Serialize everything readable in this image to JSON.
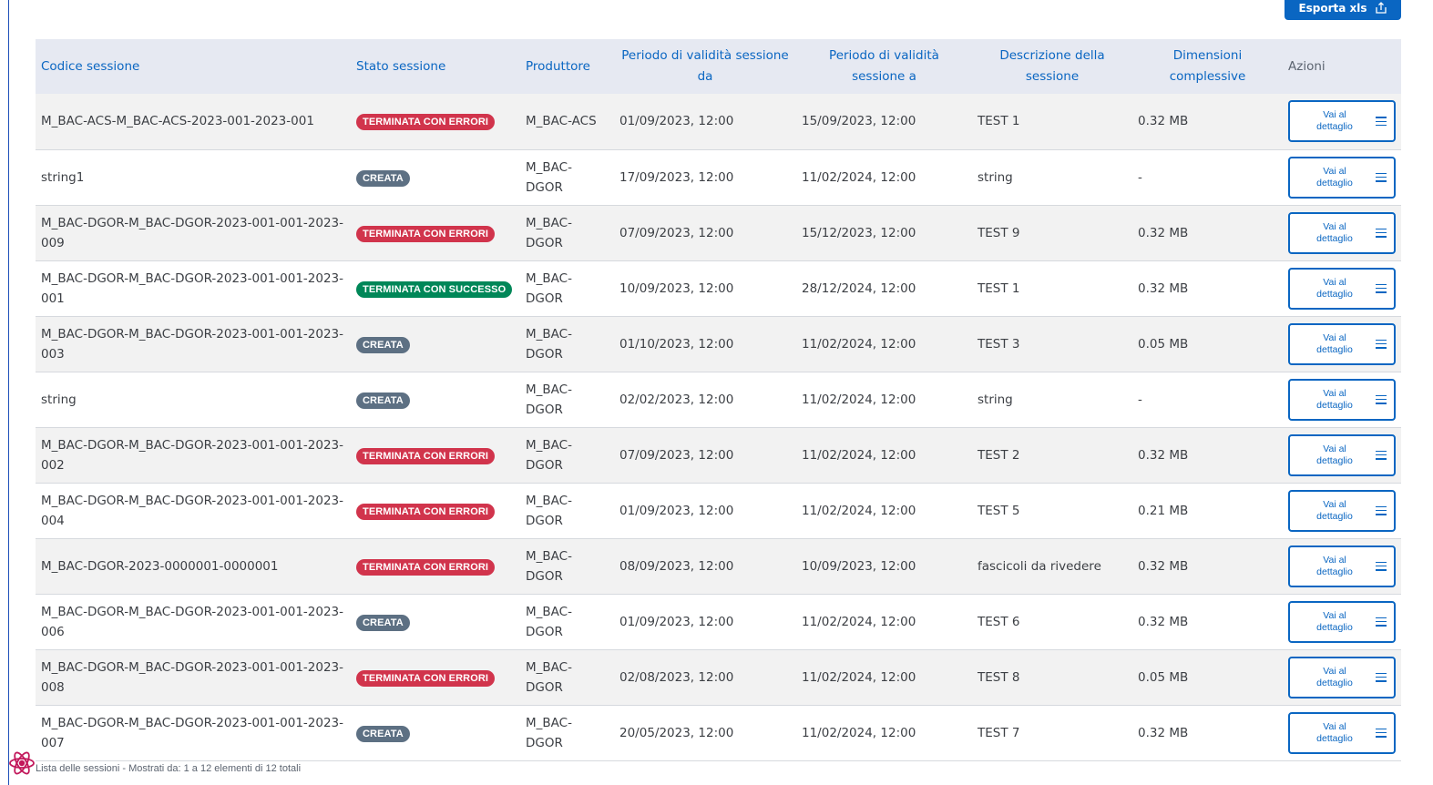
{
  "toolbar": {
    "export_label": "Esporta xls"
  },
  "table": {
    "headers": {
      "codice": "Codice sessione",
      "stato": "Stato sessione",
      "produttore": "Produttore",
      "da": "Periodo di validità sessione da",
      "a": "Periodo di validità sessione a",
      "descrizione": "Descrizione della sessione",
      "dimensioni": "Dimensioni complessive",
      "azioni": "Azioni"
    },
    "rows": [
      {
        "codice": "M_BAC-ACS-M_BAC-ACS-2023-001-2023-001",
        "stato": "TERMINATA CON ERRORI",
        "produttore": "M_BAC-ACS",
        "da": "01/09/2023, 12:00",
        "a": "15/09/2023, 12:00",
        "descrizione": "TEST 1",
        "dimensioni": "0.32 MB",
        "azione": "Vai al dettaglio"
      },
      {
        "codice": "string1",
        "stato": "CREATA",
        "produttore": "M_BAC-DGOR",
        "da": "17/09/2023, 12:00",
        "a": "11/02/2024, 12:00",
        "descrizione": "string",
        "dimensioni": "-",
        "azione": "Vai al dettaglio"
      },
      {
        "codice": "M_BAC-DGOR-M_BAC-DGOR-2023-001-001-2023-009",
        "stato": "TERMINATA CON ERRORI",
        "produttore": "M_BAC-DGOR",
        "da": "07/09/2023, 12:00",
        "a": "15/12/2023, 12:00",
        "descrizione": "TEST 9",
        "dimensioni": "0.32 MB",
        "azione": "Vai al dettaglio"
      },
      {
        "codice": "M_BAC-DGOR-M_BAC-DGOR-2023-001-001-2023-001",
        "stato": "TERMINATA CON SUCCESSO",
        "produttore": "M_BAC-DGOR",
        "da": "10/09/2023, 12:00",
        "a": "28/12/2024, 12:00",
        "descrizione": "TEST 1",
        "dimensioni": "0.32 MB",
        "azione": "Vai al dettaglio"
      },
      {
        "codice": "M_BAC-DGOR-M_BAC-DGOR-2023-001-001-2023-003",
        "stato": "CREATA",
        "produttore": "M_BAC-DGOR",
        "da": "01/10/2023, 12:00",
        "a": "11/02/2024, 12:00",
        "descrizione": "TEST 3",
        "dimensioni": "0.05 MB",
        "azione": "Vai al dettaglio"
      },
      {
        "codice": "string",
        "stato": "CREATA",
        "produttore": "M_BAC-DGOR",
        "da": "02/02/2023, 12:00",
        "a": "11/02/2024, 12:00",
        "descrizione": "string",
        "dimensioni": "-",
        "azione": "Vai al dettaglio"
      },
      {
        "codice": "M_BAC-DGOR-M_BAC-DGOR-2023-001-001-2023-002",
        "stato": "TERMINATA CON ERRORI",
        "produttore": "M_BAC-DGOR",
        "da": "07/09/2023, 12:00",
        "a": "11/02/2024, 12:00",
        "descrizione": "TEST 2",
        "dimensioni": "0.32 MB",
        "azione": "Vai al dettaglio"
      },
      {
        "codice": "M_BAC-DGOR-M_BAC-DGOR-2023-001-001-2023-004",
        "stato": "TERMINATA CON ERRORI",
        "produttore": "M_BAC-DGOR",
        "da": "01/09/2023, 12:00",
        "a": "11/02/2024, 12:00",
        "descrizione": "TEST 5",
        "dimensioni": "0.21 MB",
        "azione": "Vai al dettaglio"
      },
      {
        "codice": "M_BAC-DGOR-2023-0000001-0000001",
        "stato": "TERMINATA CON ERRORI",
        "produttore": "M_BAC-DGOR",
        "da": "08/09/2023, 12:00",
        "a": "10/09/2023, 12:00",
        "descrizione": "fascicoli da rivedere",
        "dimensioni": "0.32 MB",
        "azione": "Vai al dettaglio"
      },
      {
        "codice": "M_BAC-DGOR-M_BAC-DGOR-2023-001-001-2023-006",
        "stato": "CREATA",
        "produttore": "M_BAC-DGOR",
        "da": "01/09/2023, 12:00",
        "a": "11/02/2024, 12:00",
        "descrizione": "TEST 6",
        "dimensioni": "0.32 MB",
        "azione": "Vai al dettaglio"
      },
      {
        "codice": "M_BAC-DGOR-M_BAC-DGOR-2023-001-001-2023-008",
        "stato": "TERMINATA CON ERRORI",
        "produttore": "M_BAC-DGOR",
        "da": "02/08/2023, 12:00",
        "a": "11/02/2024, 12:00",
        "descrizione": "TEST 8",
        "dimensioni": "0.05 MB",
        "azione": "Vai al dettaglio"
      },
      {
        "codice": "M_BAC-DGOR-M_BAC-DGOR-2023-001-001-2023-007",
        "stato": "CREATA",
        "produttore": "M_BAC-DGOR",
        "da": "20/05/2023, 12:00",
        "a": "11/02/2024, 12:00",
        "descrizione": "TEST 7",
        "dimensioni": "0.32 MB",
        "azione": "Vai al dettaglio"
      }
    ]
  },
  "footer": {
    "text": "Lista delle sessioni - Mostrati da: 1 a 12 elementi di 12 totali"
  },
  "colors": {
    "primary": "#0a66c2",
    "status_error": "#d1344c",
    "status_success": "#008758",
    "status_created": "#5d7083"
  }
}
